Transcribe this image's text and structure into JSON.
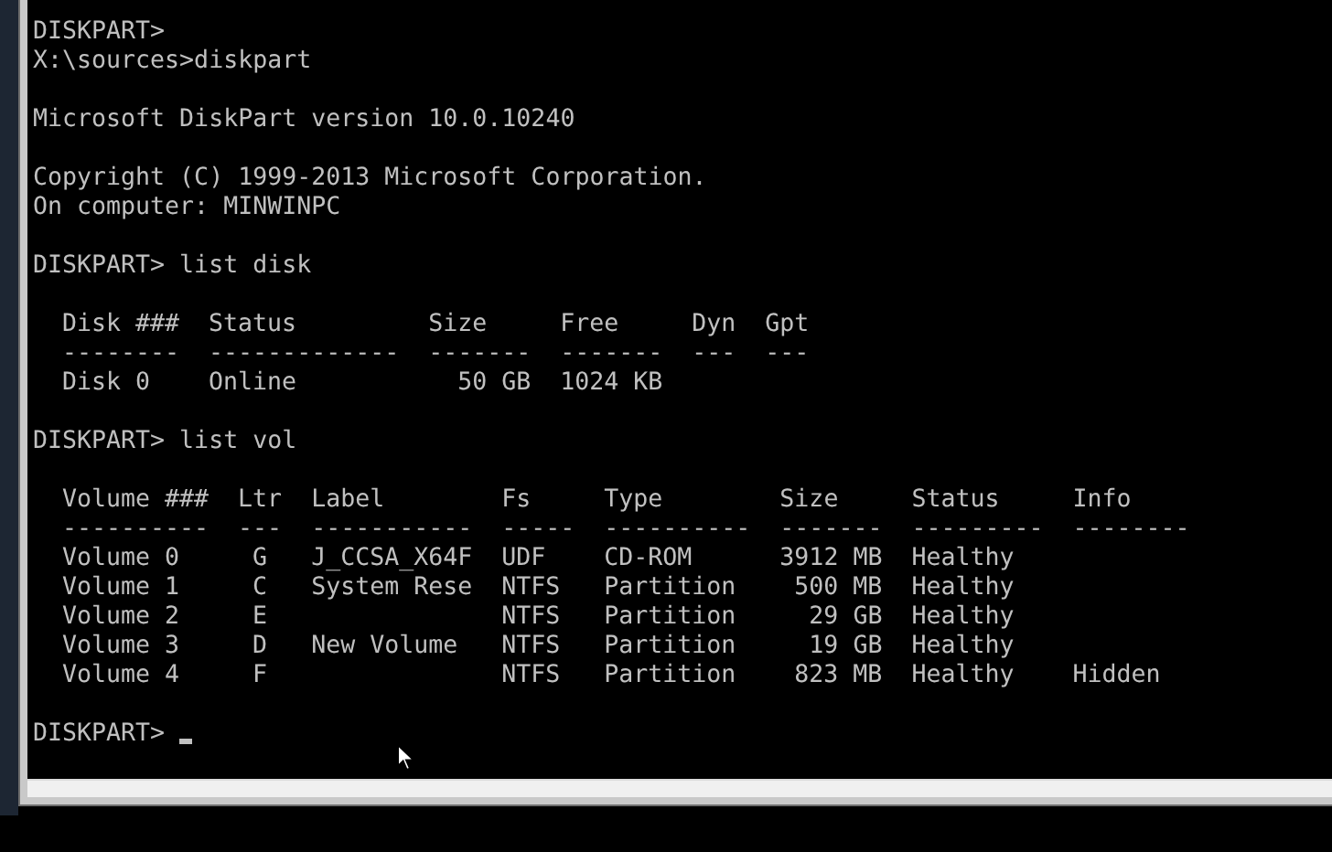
{
  "console": {
    "blocks": [
      {
        "kind": "text",
        "lines": [
          "DISKPART>",
          "X:\\sources>diskpart"
        ]
      },
      {
        "kind": "text",
        "lines": [
          "Microsoft DiskPart version 10.0.10240"
        ]
      },
      {
        "kind": "text",
        "lines": [
          "Copyright (C) 1999-2013 Microsoft Corporation.",
          "On computer: MINWINPC"
        ]
      },
      {
        "kind": "text",
        "lines": [
          "DISKPART> list disk"
        ]
      },
      {
        "kind": "disk_table",
        "columns": [
          {
            "header": "Disk ###",
            "rule": "--------"
          },
          {
            "header": "Status",
            "rule": "-------------"
          },
          {
            "header": "Size",
            "rule": "-------"
          },
          {
            "header": "Free",
            "rule": "-------"
          },
          {
            "header": "Dyn",
            "rule": "---"
          },
          {
            "header": "Gpt",
            "rule": "---"
          }
        ],
        "rows": [
          [
            "Disk 0",
            "Online",
            "50 GB",
            "1024 KB"
          ]
        ]
      },
      {
        "kind": "text",
        "lines": [
          "DISKPART> list vol"
        ]
      },
      {
        "kind": "volume_table",
        "columns": [
          {
            "header": "Volume ###",
            "rule": "----------"
          },
          {
            "header": "Ltr",
            "rule": "---"
          },
          {
            "header": "Label",
            "rule": "-----------"
          },
          {
            "header": "Fs",
            "rule": "-----"
          },
          {
            "header": "Type",
            "rule": "----------"
          },
          {
            "header": "Size",
            "rule": "-------"
          },
          {
            "header": "Status",
            "rule": "---------"
          },
          {
            "header": "Info",
            "rule": "--------"
          }
        ],
        "rows": [
          [
            "Volume 0",
            "G",
            "J_CCSA_X64F",
            "UDF",
            "CD-ROM",
            "3912 MB",
            "Healthy"
          ],
          [
            "Volume 1",
            "C",
            "System Rese",
            "NTFS",
            "Partition",
            "500 MB",
            "Healthy"
          ],
          [
            "Volume 2",
            "E",
            null,
            "NTFS",
            "Partition",
            "29 GB",
            "Healthy"
          ],
          [
            "Volume 3",
            "D",
            "New Volume",
            "NTFS",
            "Partition",
            "19 GB",
            "Healthy"
          ],
          [
            "Volume 4",
            "F",
            null,
            "NTFS",
            "Partition",
            "823 MB",
            "Healthy",
            "Hidden"
          ]
        ]
      },
      {
        "kind": "prompt",
        "text": "DISKPART>"
      }
    ]
  }
}
